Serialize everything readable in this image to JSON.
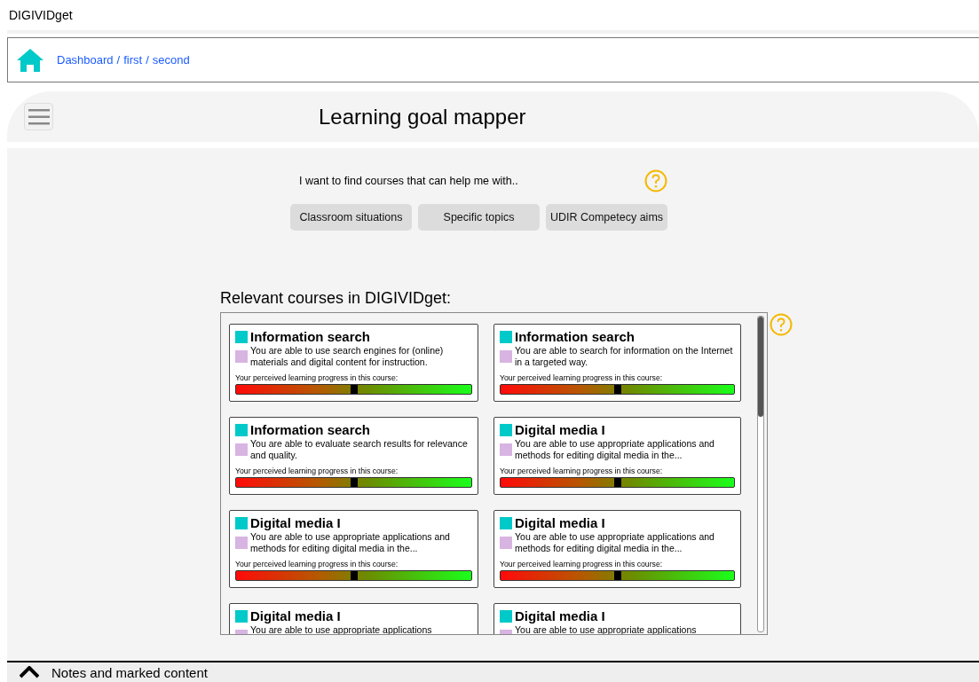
{
  "app_title": "DIGIVIDget",
  "breadcrumb": {
    "separator": "/",
    "items": [
      "Dashboard",
      "first",
      "second"
    ]
  },
  "header": {
    "title": "Learning goal mapper"
  },
  "finder": {
    "prompt": "I want to find courses that can help me with..",
    "buttons": [
      "Classroom situations",
      "Specific topics",
      "UDIR Competecy aims"
    ]
  },
  "courses": {
    "heading": "Relevant courses in DIGIVIDget:",
    "items": [
      {
        "title": "Information search",
        "description": "You are able to use search engines for (online) materials and digital content for instruction.",
        "progress_label": "Your perceived learning progress in this course:",
        "level": 0.5
      },
      {
        "title": "Information search",
        "description": "You are able to search for information on the Internet in a targeted way.",
        "progress_label": "Your perceived learning progress in this course:",
        "level": 0.5
      },
      {
        "title": "Information search",
        "description": "You are able to evaluate search results for relevance and quality.",
        "progress_label": "Your perceived learning progress in this course:",
        "level": 0.5
      },
      {
        "title": "Digital media I",
        "description": "You are able to use appropriate applications and methods for editing digital media in the...",
        "progress_label": "Your perceived learning progress in this course:",
        "level": 0.5
      },
      {
        "title": "Digital media I",
        "description": "You are able to use appropriate applications and methods for editing digital media in the...",
        "progress_label": "Your perceived learning progress in this course:",
        "level": 0.5
      },
      {
        "title": "Digital media I",
        "description": "You are able to use appropriate applications and methods for editing digital media in the...",
        "progress_label": "Your perceived learning progress in this course:",
        "level": 0.5
      },
      {
        "title": "Digital media I",
        "description": "You are able to use appropriate applications"
      },
      {
        "title": "Digital media I",
        "description": "You are able to use appropriate applications"
      }
    ]
  },
  "notes_bar": {
    "label": "Notes and marked content"
  }
}
